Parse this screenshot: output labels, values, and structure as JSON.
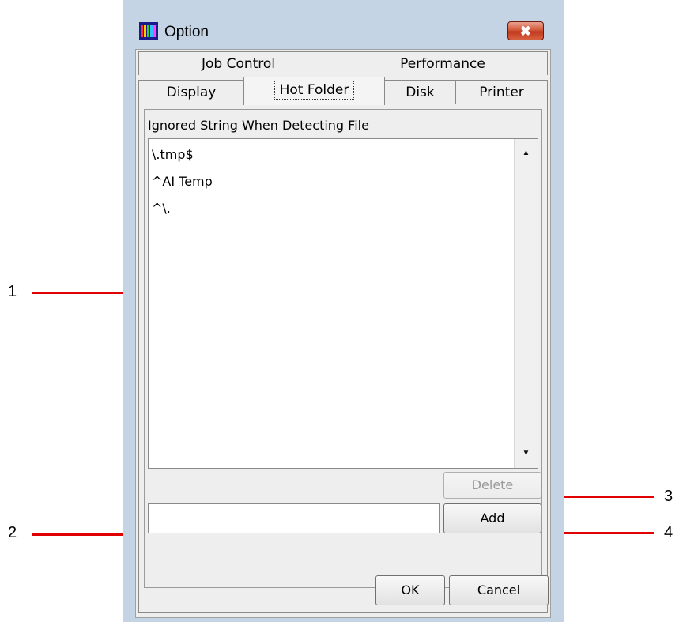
{
  "window": {
    "title": "Option",
    "close_glyph": "✖"
  },
  "tabs": {
    "row1": [
      "Job Control",
      "Performance"
    ],
    "row2": [
      "Display",
      "Hot Folder",
      "Disk",
      "Printer"
    ],
    "active": "Hot Folder"
  },
  "panel": {
    "group_label": "Ignored String When Detecting File",
    "list_items": [
      "\\.tmp$",
      "^AI Temp",
      "^\\."
    ],
    "scroll_up_glyph": "▲",
    "scroll_down_glyph": "▼",
    "input_value": "",
    "delete_label": "Delete",
    "add_label": "Add"
  },
  "footer": {
    "ok_label": "OK",
    "cancel_label": "Cancel"
  },
  "callouts": [
    "1",
    "2",
    "3",
    "4"
  ],
  "colors": {
    "callout_line": "#e00000",
    "window_frame": "#c5d4e5",
    "close_button": "#c03a20"
  },
  "icons": [
    "app-icon",
    "close-icon",
    "scroll-up-icon",
    "scroll-down-icon"
  ]
}
